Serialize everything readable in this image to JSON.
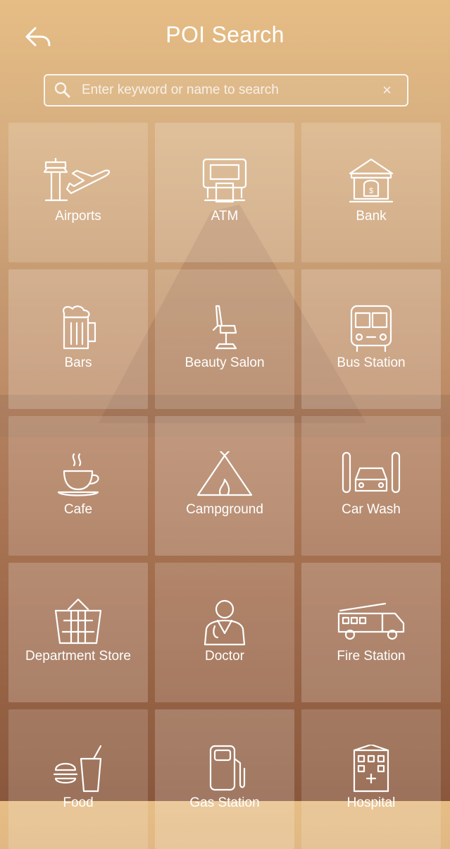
{
  "header": {
    "title": "POI Search"
  },
  "search": {
    "placeholder": "Enter keyword or name to search",
    "clear_symbol": "×"
  },
  "categories": [
    {
      "label": "Airports",
      "icon": "airport-icon"
    },
    {
      "label": "ATM",
      "icon": "atm-icon"
    },
    {
      "label": "Bank",
      "icon": "bank-icon"
    },
    {
      "label": "Bars",
      "icon": "beer-mug-icon"
    },
    {
      "label": "Beauty Salon",
      "icon": "salon-chair-icon"
    },
    {
      "label": "Bus Station",
      "icon": "bus-icon"
    },
    {
      "label": "Cafe",
      "icon": "coffee-cup-icon"
    },
    {
      "label": "Campground",
      "icon": "tent-icon"
    },
    {
      "label": "Car Wash",
      "icon": "car-wash-icon"
    },
    {
      "label": "Department Store",
      "icon": "basket-icon"
    },
    {
      "label": "Doctor",
      "icon": "doctor-icon"
    },
    {
      "label": "Fire Station",
      "icon": "fire-truck-icon"
    },
    {
      "label": "Food",
      "icon": "food-icon"
    },
    {
      "label": "Gas Station",
      "icon": "gas-pump-icon"
    },
    {
      "label": "Hospital",
      "icon": "hospital-icon"
    }
  ]
}
